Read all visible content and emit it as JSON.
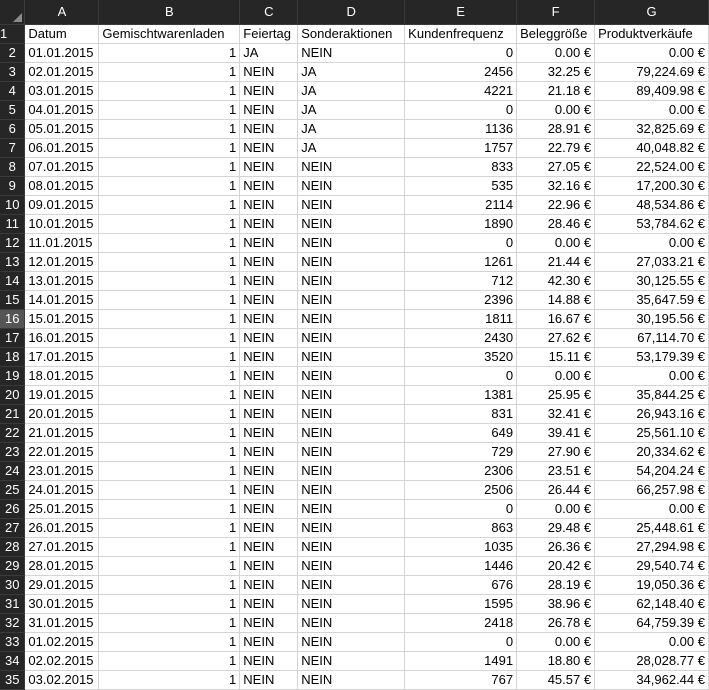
{
  "columns": [
    "A",
    "B",
    "C",
    "D",
    "E",
    "F",
    "G"
  ],
  "headers": [
    "Datum",
    "Gemischtwarenladen",
    "Feiertag",
    "Sonderaktionen",
    "Kundenfrequenz",
    "Beleggröße",
    "Produktverkäufe"
  ],
  "selected_row_number": 16,
  "rows": [
    [
      "01.01.2015",
      "1",
      "JA",
      "NEIN",
      "0",
      "0.00 €",
      "0.00 €"
    ],
    [
      "02.01.2015",
      "1",
      "NEIN",
      "JA",
      "2456",
      "32.25 €",
      "79,224.69 €"
    ],
    [
      "03.01.2015",
      "1",
      "NEIN",
      "JA",
      "4221",
      "21.18 €",
      "89,409.98 €"
    ],
    [
      "04.01.2015",
      "1",
      "NEIN",
      "JA",
      "0",
      "0.00 €",
      "0.00 €"
    ],
    [
      "05.01.2015",
      "1",
      "NEIN",
      "JA",
      "1136",
      "28.91 €",
      "32,825.69 €"
    ],
    [
      "06.01.2015",
      "1",
      "NEIN",
      "JA",
      "1757",
      "22.79 €",
      "40,048.82 €"
    ],
    [
      "07.01.2015",
      "1",
      "NEIN",
      "NEIN",
      "833",
      "27.05 €",
      "22,524.00 €"
    ],
    [
      "08.01.2015",
      "1",
      "NEIN",
      "NEIN",
      "535",
      "32.16 €",
      "17,200.30 €"
    ],
    [
      "09.01.2015",
      "1",
      "NEIN",
      "NEIN",
      "2114",
      "22.96 €",
      "48,534.86 €"
    ],
    [
      "10.01.2015",
      "1",
      "NEIN",
      "NEIN",
      "1890",
      "28.46 €",
      "53,784.62 €"
    ],
    [
      "11.01.2015",
      "1",
      "NEIN",
      "NEIN",
      "0",
      "0.00 €",
      "0.00 €"
    ],
    [
      "12.01.2015",
      "1",
      "NEIN",
      "NEIN",
      "1261",
      "21.44 €",
      "27,033.21 €"
    ],
    [
      "13.01.2015",
      "1",
      "NEIN",
      "NEIN",
      "712",
      "42.30 €",
      "30,125.55 €"
    ],
    [
      "14.01.2015",
      "1",
      "NEIN",
      "NEIN",
      "2396",
      "14.88 €",
      "35,647.59 €"
    ],
    [
      "15.01.2015",
      "1",
      "NEIN",
      "NEIN",
      "1811",
      "16.67 €",
      "30,195.56 €"
    ],
    [
      "16.01.2015",
      "1",
      "NEIN",
      "NEIN",
      "2430",
      "27.62 €",
      "67,114.70 €"
    ],
    [
      "17.01.2015",
      "1",
      "NEIN",
      "NEIN",
      "3520",
      "15.11 €",
      "53,179.39 €"
    ],
    [
      "18.01.2015",
      "1",
      "NEIN",
      "NEIN",
      "0",
      "0.00 €",
      "0.00 €"
    ],
    [
      "19.01.2015",
      "1",
      "NEIN",
      "NEIN",
      "1381",
      "25.95 €",
      "35,844.25 €"
    ],
    [
      "20.01.2015",
      "1",
      "NEIN",
      "NEIN",
      "831",
      "32.41 €",
      "26,943.16 €"
    ],
    [
      "21.01.2015",
      "1",
      "NEIN",
      "NEIN",
      "649",
      "39.41 €",
      "25,561.10 €"
    ],
    [
      "22.01.2015",
      "1",
      "NEIN",
      "NEIN",
      "729",
      "27.90 €",
      "20,334.62 €"
    ],
    [
      "23.01.2015",
      "1",
      "NEIN",
      "NEIN",
      "2306",
      "23.51 €",
      "54,204.24 €"
    ],
    [
      "24.01.2015",
      "1",
      "NEIN",
      "NEIN",
      "2506",
      "26.44 €",
      "66,257.98 €"
    ],
    [
      "25.01.2015",
      "1",
      "NEIN",
      "NEIN",
      "0",
      "0.00 €",
      "0.00 €"
    ],
    [
      "26.01.2015",
      "1",
      "NEIN",
      "NEIN",
      "863",
      "29.48 €",
      "25,448.61 €"
    ],
    [
      "27.01.2015",
      "1",
      "NEIN",
      "NEIN",
      "1035",
      "26.36 €",
      "27,294.98 €"
    ],
    [
      "28.01.2015",
      "1",
      "NEIN",
      "NEIN",
      "1446",
      "20.42 €",
      "29,540.74 €"
    ],
    [
      "29.01.2015",
      "1",
      "NEIN",
      "NEIN",
      "676",
      "28.19 €",
      "19,050.36 €"
    ],
    [
      "30.01.2015",
      "1",
      "NEIN",
      "NEIN",
      "1595",
      "38.96 €",
      "62,148.40 €"
    ],
    [
      "31.01.2015",
      "1",
      "NEIN",
      "NEIN",
      "2418",
      "26.78 €",
      "64,759.39 €"
    ],
    [
      "01.02.2015",
      "1",
      "NEIN",
      "NEIN",
      "0",
      "0.00 €",
      "0.00 €"
    ],
    [
      "02.02.2015",
      "1",
      "NEIN",
      "NEIN",
      "1491",
      "18.80 €",
      "28,028.77 €"
    ],
    [
      "03.02.2015",
      "1",
      "NEIN",
      "NEIN",
      "767",
      "45.57 €",
      "34,962.44 €"
    ]
  ]
}
